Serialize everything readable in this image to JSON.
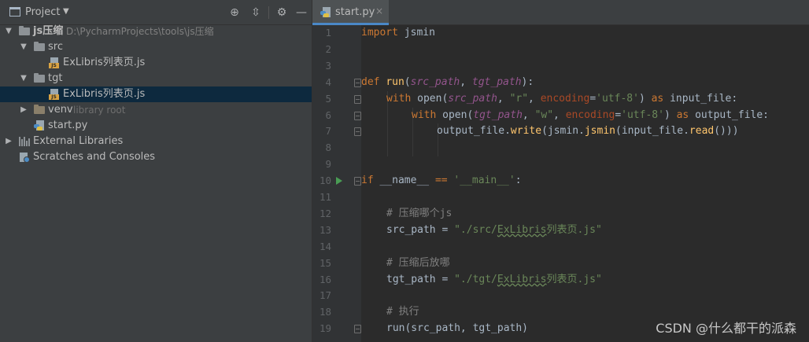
{
  "project": {
    "title": "Project",
    "tree": {
      "root_name": "js压缩",
      "root_path": "D:\\PycharmProjects\\tools\\js压缩",
      "src_folder": "src",
      "src_file": "ExLibris列表页.js",
      "tgt_folder": "tgt",
      "tgt_file": "ExLibris列表页.js",
      "venv_folder": "venv",
      "venv_hint": "library root",
      "start_file": "start.py",
      "external_libraries": "External Libraries",
      "scratches": "Scratches and Consoles"
    }
  },
  "editor": {
    "tab_label": "start.py",
    "tab_close": "×",
    "line_numbers": [
      "1",
      "2",
      "3",
      "4",
      "5",
      "6",
      "7",
      "8",
      "9",
      "10",
      "11",
      "12",
      "13",
      "14",
      "15",
      "16",
      "17",
      "18",
      "19"
    ]
  },
  "code": {
    "l1": {
      "kw": "import",
      "rest": " jsmin"
    },
    "l4": {
      "kw": "def",
      "sp": " ",
      "fn": "run",
      "p1": "(",
      "a1": "src_path",
      "c1": ", ",
      "a2": "tgt_path",
      "p2": "):"
    },
    "l5": {
      "kw": "with",
      "t1": " open(",
      "a1": "src_path",
      "t2": ", ",
      "s1": "\"r\"",
      "t3": ", ",
      "kwarg": "encoding",
      "t4": "=",
      "s2": "'utf-8'",
      "t5": ") ",
      "kw2": "as",
      "t6": " input_file:"
    },
    "l6": {
      "kw": "with",
      "t1": " open(",
      "a1": "tgt_path",
      "t2": ", ",
      "s1": "\"w\"",
      "t3": ", ",
      "kwarg": "encoding",
      "t4": "=",
      "s2": "'utf-8'",
      "t5": ") ",
      "kw2": "as",
      "t6": " output_file:"
    },
    "l7": {
      "t1": "output_file.",
      "fn1": "write",
      "t2": "(jsmin.",
      "fn2": "jsmin",
      "t3": "(input_file.",
      "fn3": "read",
      "t4": "()))"
    },
    "l10": {
      "kw": "if",
      "t1": " __name__ ",
      "op": "==",
      "t2": " ",
      "s1": "'__main__'",
      "t3": ":"
    },
    "l12": {
      "cmt": "# 压缩哪个js"
    },
    "l13": {
      "t1": "src_path = ",
      "s1a": "\"./src/",
      "s1b": "ExLibris",
      "s1c": "列表页.js\""
    },
    "l15": {
      "cmt": "# 压缩后放哪"
    },
    "l16": {
      "t1": "tgt_path = ",
      "s1a": "\"./tgt/",
      "s1b": "ExLibris",
      "s1c": "列表页.js\""
    },
    "l18": {
      "cmt": "# 执行"
    },
    "l19": {
      "t1": "run(src_path, tgt_path)"
    }
  },
  "watermark": "CSDN @什么都干的派森",
  "colors": {
    "keyword": "#cc7832",
    "function": "#ffc66d",
    "param": "#94558d",
    "string": "#6a8759",
    "comment": "#808080",
    "selection": "#0d293e",
    "tab_underline": "#4a88c7"
  }
}
